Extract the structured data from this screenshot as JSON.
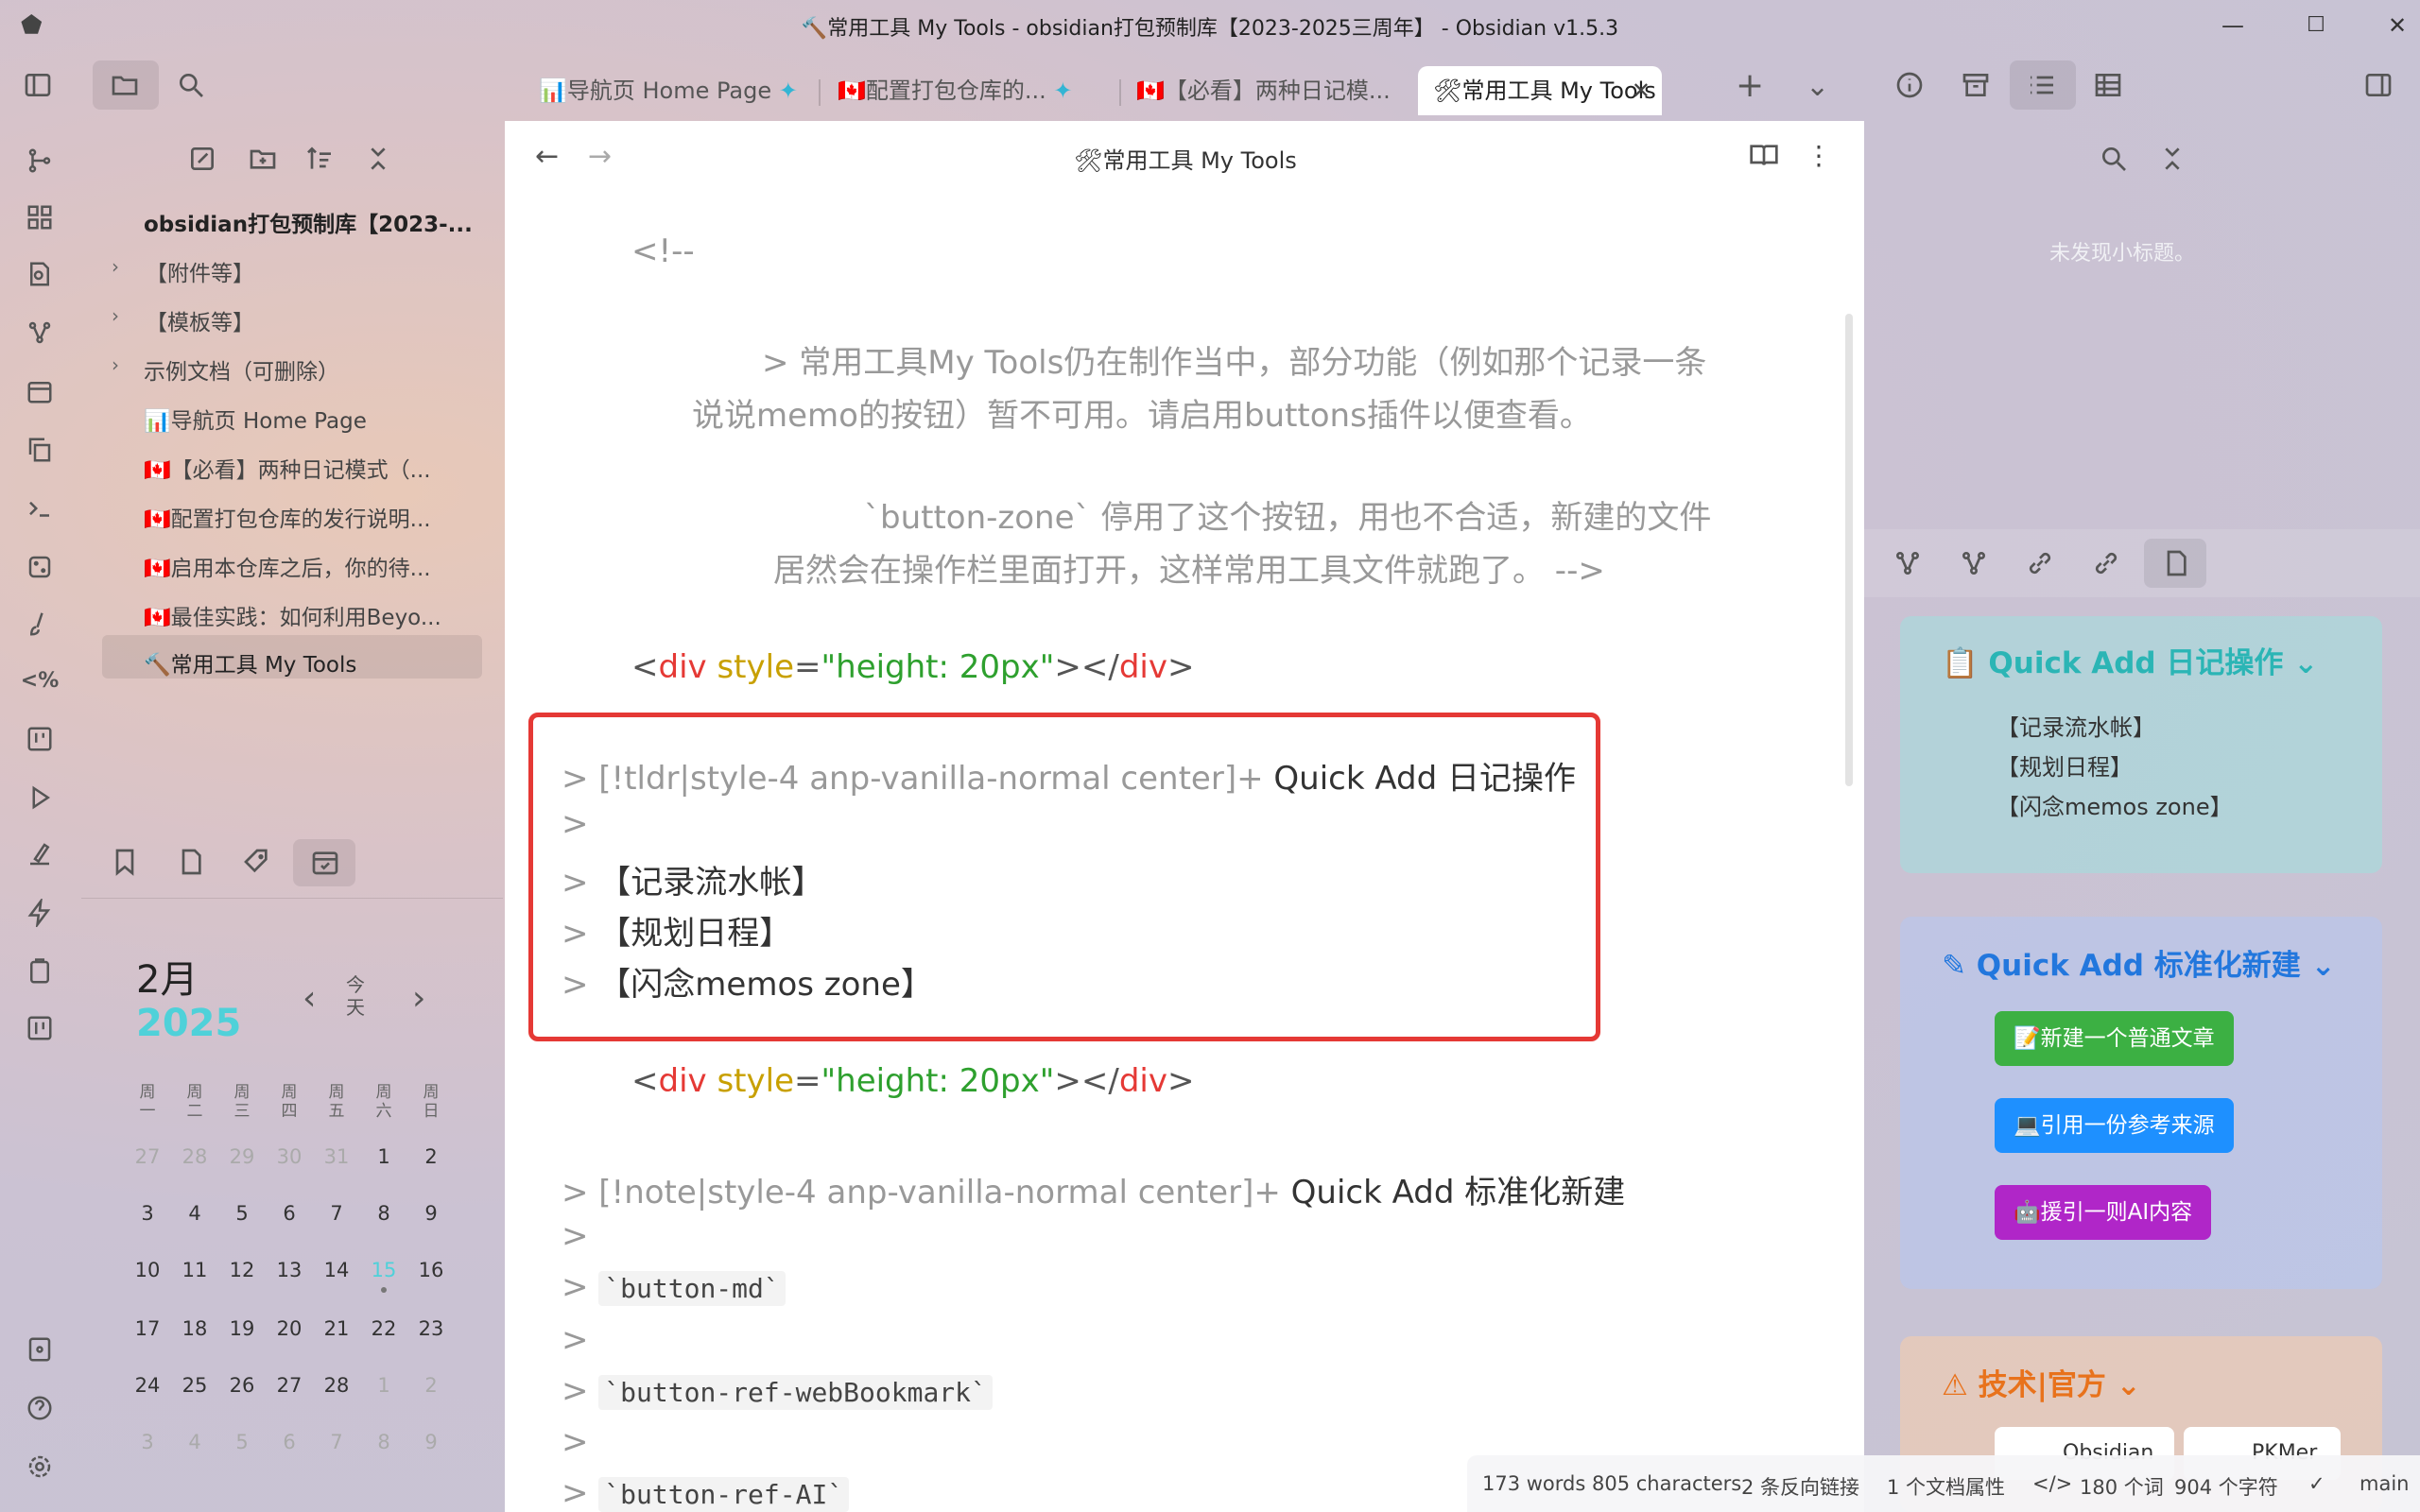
{
  "window": {
    "title": "🔨常用工具 My Tools - obsidian打包预制库【2023-2025三周年】 - Obsidian v1.5.3",
    "minimize": "—",
    "maximize": "☐",
    "close": "✕"
  },
  "tabs": [
    {
      "label": "📊导航页 Home Page",
      "pinned": true
    },
    {
      "label": "🇨🇦配置打包仓库的...",
      "pinned": true
    },
    {
      "label": "🇨🇦【必看】两种日记模...",
      "pinned": false
    },
    {
      "label": "🛠常用工具 My Tools",
      "pinned": false,
      "active": true
    }
  ],
  "tab_controls": {
    "new_tab": "+",
    "tab_list": "⌄"
  },
  "file_explorer": {
    "vault_name": "obsidian打包预制库【2023-...",
    "folders": [
      "【附件等】",
      "【模板等】",
      "示例文档（可删除）"
    ],
    "files": [
      "📊导航页 Home Page",
      "🇨🇦【必看】两种日记模式（...",
      "🇨🇦配置打包仓库的发行说明...",
      "🇨🇦启用本仓库之后，你的待...",
      "🇨🇦最佳实践：如何利用Beyo...",
      "🔨常用工具 My Tools"
    ]
  },
  "editor": {
    "header_title": "🛠常用工具 My Tools",
    "comment_open": "<!--",
    "comment_line1": "> 常用工具My Tools仍在制作当中，部分功能（例如那个记录一条",
    "comment_line2": "说说memo的按钮）暂不可用。请启用buttons插件以便查看。",
    "comment_line3": "`button-zone` 停用了这个按钮，用也不合适，新建的文件",
    "comment_line4": "居然会在操作栏里面打开，这样常用工具文件就跑了。 -->",
    "div_open": "<",
    "div_tag": "div",
    "div_attr": "style",
    "div_eq": "=",
    "div_val": "\"height: 20px\"",
    "div_close1": "></",
    "div_tag2": "div",
    "div_close2": ">",
    "callout1_prefix": "> [!tldr|style-4 anp-vanilla-normal center]+",
    "callout1_title": " Quick Add 日记操作",
    "quote_marker": ">",
    "callout1_items": [
      "【记录流水帐】",
      "【规划日程】",
      "【闪念memos zone】"
    ],
    "callout2_prefix": "> [!note|style-4 anp-vanilla-normal center]+",
    "callout2_title": " Quick Add 标准化新建",
    "code1": "`button-md`",
    "code2": "`button-ref-webBookmark`",
    "code3": "`button-ref-AI`"
  },
  "calendar": {
    "month": "2月",
    "year": "2025",
    "today": "今\n天",
    "weekdays": [
      "周\n一",
      "周\n二",
      "周\n三",
      "周\n四",
      "周\n五",
      "周\n六",
      "周\n日"
    ],
    "weeks": [
      [
        "27",
        "28",
        "29",
        "30",
        "31",
        "1",
        "2"
      ],
      [
        "3",
        "4",
        "5",
        "6",
        "7",
        "8",
        "9"
      ],
      [
        "10",
        "11",
        "12",
        "13",
        "14",
        "15",
        "16"
      ],
      [
        "17",
        "18",
        "19",
        "20",
        "21",
        "22",
        "23"
      ],
      [
        "24",
        "25",
        "26",
        "27",
        "28",
        "1",
        "2"
      ],
      [
        "3",
        "4",
        "5",
        "6",
        "7",
        "8",
        "9"
      ]
    ],
    "today_date": "15"
  },
  "right_panel": {
    "search_hint": "未发现小标题。",
    "callout1_title": "Quick Add 日记操作",
    "callout1_items": [
      "【记录流水帐】",
      "【规划日程】",
      "【闪念memos zone】"
    ],
    "callout2_title": "Quick Add 标准化新建",
    "buttons": [
      {
        "label": "📝新建一个普通文章",
        "color": "#3cb043"
      },
      {
        "label": "💻引用一份参考来源",
        "color": "#1e90ff"
      },
      {
        "label": "🤖援引一则AI内容",
        "color": "#b026c8"
      }
    ],
    "callout3_title": "技术|官方",
    "badges": [
      "Obsidian",
      "PKMer"
    ]
  },
  "status_bar": {
    "words": "173 words 805 characters",
    "backlinks": "2 条反向链接",
    "properties": "1 个文档属性",
    "code_icon": "</>",
    "word_count": "180 个词",
    "char_count": "904 个字符",
    "check": "✓",
    "branch": "main"
  },
  "colors": {
    "accent_teal": "#2bb5b5",
    "accent_blue": "#2277dd",
    "accent_orange": "#e8721c",
    "highlight_box": "#e53935"
  }
}
